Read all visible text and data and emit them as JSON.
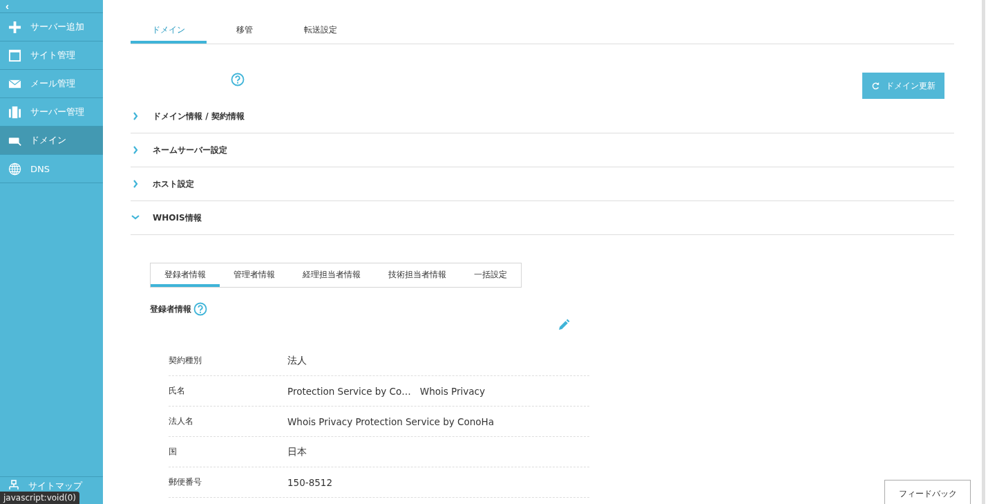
{
  "sidebar": {
    "collapse": "‹",
    "items": [
      {
        "label": "サーバー追加",
        "selected": false
      },
      {
        "label": "サイト管理",
        "selected": false
      },
      {
        "label": "メール管理",
        "selected": false
      },
      {
        "label": "サーバー管理",
        "selected": false
      },
      {
        "label": "ドメイン",
        "selected": true
      },
      {
        "label": "DNS",
        "selected": false
      }
    ],
    "footer_item": {
      "label": "サイトマップ"
    }
  },
  "tabs": [
    {
      "label": "ドメイン",
      "selected": true
    },
    {
      "label": "移管",
      "selected": false
    },
    {
      "label": "転送設定",
      "selected": false
    }
  ],
  "refresh_button": "ドメイン更新",
  "sections": [
    {
      "title": "ドメイン情報 / 契約情報",
      "expanded": false
    },
    {
      "title": "ネームサーバー設定",
      "expanded": false
    },
    {
      "title": "ホスト設定",
      "expanded": false
    },
    {
      "title": "WHOIS情報",
      "expanded": true
    }
  ],
  "whois": {
    "tabs": [
      {
        "label": "登録者情報",
        "selected": true
      },
      {
        "label": "管理者情報",
        "selected": false
      },
      {
        "label": "経理担当者情報",
        "selected": false
      },
      {
        "label": "技術担当者情報",
        "selected": false
      },
      {
        "label": "一括設定",
        "selected": false
      }
    ],
    "heading": "登録者情報",
    "rows": [
      {
        "label": "契約種別",
        "values": [
          "法人"
        ]
      },
      {
        "label": "氏名",
        "values": [
          "Protection Service by Co…",
          "Whois Privacy"
        ]
      },
      {
        "label": "法人名",
        "values": [
          "Whois Privacy Protection Service by ConoHa"
        ]
      },
      {
        "label": "国",
        "values": [
          "日本"
        ]
      },
      {
        "label": "郵便番号",
        "values": [
          "150-8512"
        ]
      }
    ]
  },
  "feedback_button": "フィードバック",
  "status_tooltip": "javascript:void(0)"
}
